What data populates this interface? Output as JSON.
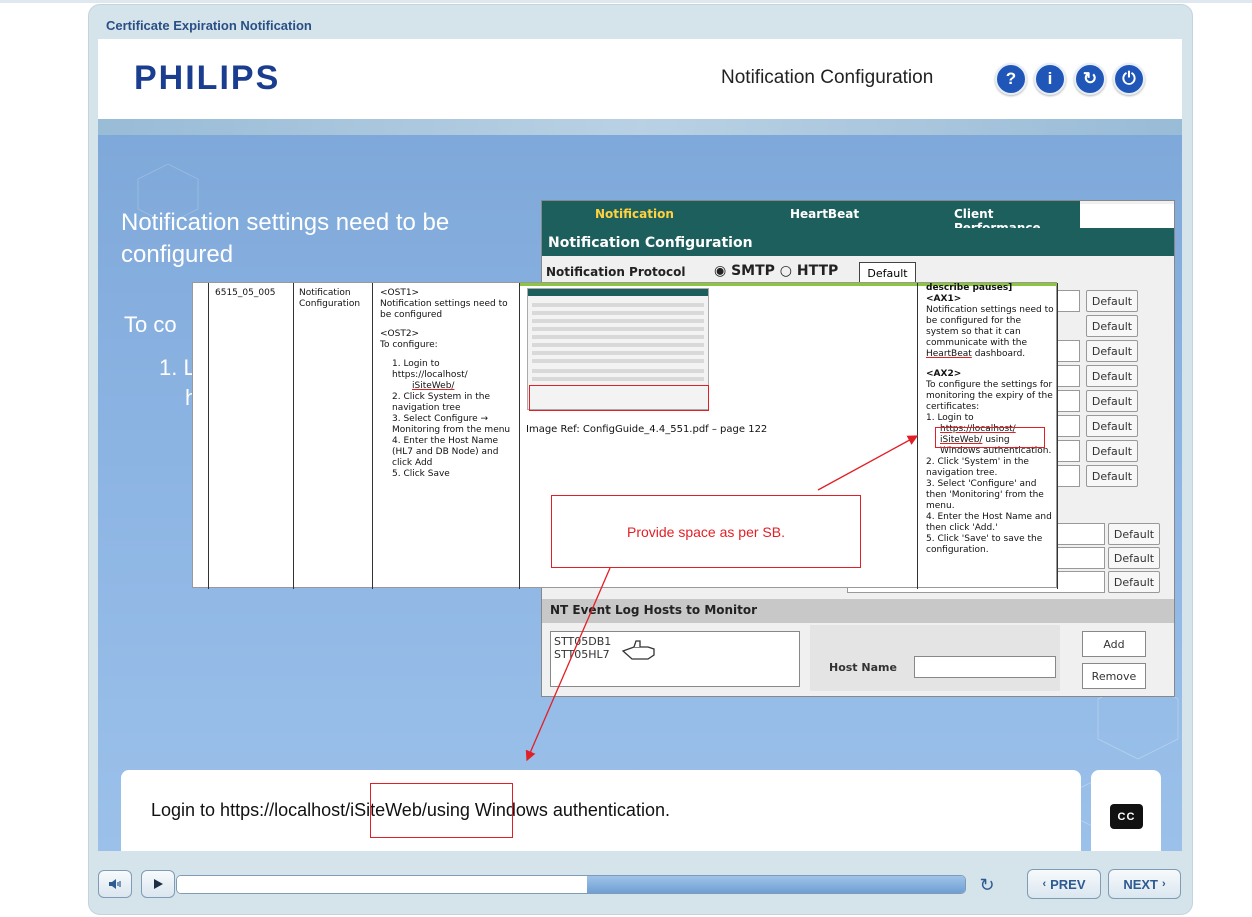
{
  "course": {
    "title": "Certificate Expiration Notification"
  },
  "header": {
    "logo": "PHILIPS",
    "nav_title": "Notification Configuration",
    "buttons": {
      "help": "?",
      "info": "i",
      "refresh": "↻",
      "power": "⏻"
    }
  },
  "slide": {
    "title": "Notification settings need to be configured",
    "text_partial_1": "To co",
    "text_partial_2": "1. L",
    "text_partial_3": "h"
  },
  "screenshot": {
    "tabs": [
      "Notification",
      "HeartBeat",
      "Client Performance"
    ],
    "heading": "Notification Configuration",
    "protocol_label": "Notification Protocol",
    "protocol_options": "◉ SMTP ○ HTTP",
    "default_label": "Default",
    "nt_heading": "NT Event Log Hosts to Monitor",
    "nt_hosts": [
      "STT05DB1",
      "STT05HL7"
    ],
    "host_name_label": "Host Name",
    "add_label": "Add",
    "remove_label": "Remove"
  },
  "storyboard": {
    "id": "6515_05_005",
    "screen": "Notification Configuration",
    "ost1_tag": "<OST1>",
    "ost1_text": "Notification settings need to be configured",
    "ost2_tag": "<OST2>",
    "ost2_text": "To configure:",
    "steps": [
      "1.  Login to https://localhost/",
      "iSiteWeb/",
      "2.  Click System in the navigation tree",
      "3.  Select Configure → Monitoring from the menu",
      "4.  Enter the Host Name (HL7 and DB Node) and click Add",
      "5.  Click Save"
    ],
    "image_ref": "Image Ref: ConfigGuide_4.4_551.pdf – page 122",
    "ax_header": "describe pauses]",
    "ax1_tag": "<AX1>",
    "ax1_text": "Notification settings need to be configured for the system so that it can communicate with the",
    "ax1_link": "HeartBeat",
    "ax1_end": "dashboard.",
    "ax2_tag": "<AX2>",
    "ax2_text": "To configure the settings for monitoring the expiry of the certificates:",
    "ax2_step1": "1.  Login to",
    "ax2_url": "https://localhost/",
    "ax2_link": "iSiteWeb/",
    "ax2_using": "using",
    "ax2_rest": "Windows authentication.",
    "ax2_steps": [
      "2.  Click 'System' in the navigation tree.",
      "3.  Select 'Configure' and then 'Monitoring' from the menu.",
      "4.  Enter the Host Name and then click 'Add.'",
      "5.  Click 'Save' to save the configuration."
    ]
  },
  "annotation": {
    "note": "Provide space as per SB."
  },
  "caption": {
    "text": "Login to https://localhost/iSiteWeb/using Windows authentication.",
    "cc_label": "CC"
  },
  "controls": {
    "prev": "PREV",
    "next": "NEXT",
    "progress_fraction": 0.52
  }
}
